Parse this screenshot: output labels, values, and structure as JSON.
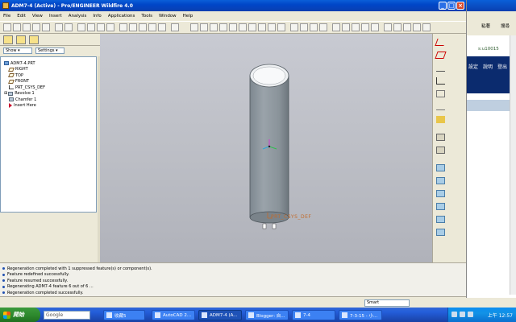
{
  "window": {
    "title": "ADM7-4 (Active) - Pro/ENGINEER Wildfire 4.0",
    "controls": [
      "minimize",
      "maximize",
      "close"
    ]
  },
  "menu": [
    "File",
    "Edit",
    "View",
    "Insert",
    "Analysis",
    "Info",
    "Applications",
    "Tools",
    "Window",
    "Help"
  ],
  "navigator": {
    "show_label": "Show ▾",
    "settings_label": "Settings ▾"
  },
  "model_tree": [
    {
      "label": "ADM7-4.PRT",
      "icon": "part-icon",
      "indent": 0
    },
    {
      "label": "RIGHT",
      "icon": "datum-plane-icon",
      "indent": 1
    },
    {
      "label": "TOP",
      "icon": "datum-plane-icon",
      "indent": 1
    },
    {
      "label": "FRONT",
      "icon": "datum-plane-icon",
      "indent": 1
    },
    {
      "label": "PRT_CSYS_DEF",
      "icon": "csys-icon",
      "indent": 1
    },
    {
      "label": "Revolve 1",
      "icon": "revolve-icon",
      "indent": 1
    },
    {
      "label": "Chamfer 1",
      "icon": "chamfer-icon",
      "indent": 1
    },
    {
      "label": "Insert Here",
      "icon": "insert-here-icon",
      "indent": 1
    }
  ],
  "graphics": {
    "csys_label": "PRT_CSYS_DEF"
  },
  "messages": [
    "Regeneration completed with 1 suppressed feature(s) or component(s).",
    "Feature redefined successfully.",
    "Feature resumed successfully.",
    "Regenerating ADM7-4 feature 6 out of 6 ...",
    "Regeneration completed successfully."
  ],
  "status": {
    "filter_value": "Smart"
  },
  "background_window": {
    "text1": "粘著",
    "text2": "搜尋",
    "text3": "s:u10015",
    "nav1": "設定",
    "nav2": "說明",
    "nav3": "登出"
  },
  "taskbar": {
    "start_label": "開始",
    "search_placeholder": "Google",
    "tasks": [
      {
        "label": "收藏5"
      },
      {
        "label": "AutoCAD 2..."
      },
      {
        "label": "ADM7-4 (A..."
      },
      {
        "label": "Blogger: 自..."
      },
      {
        "label": "7-4"
      },
      {
        "label": "7-3-15 - 小..."
      }
    ],
    "clock": "上午 12:57"
  }
}
